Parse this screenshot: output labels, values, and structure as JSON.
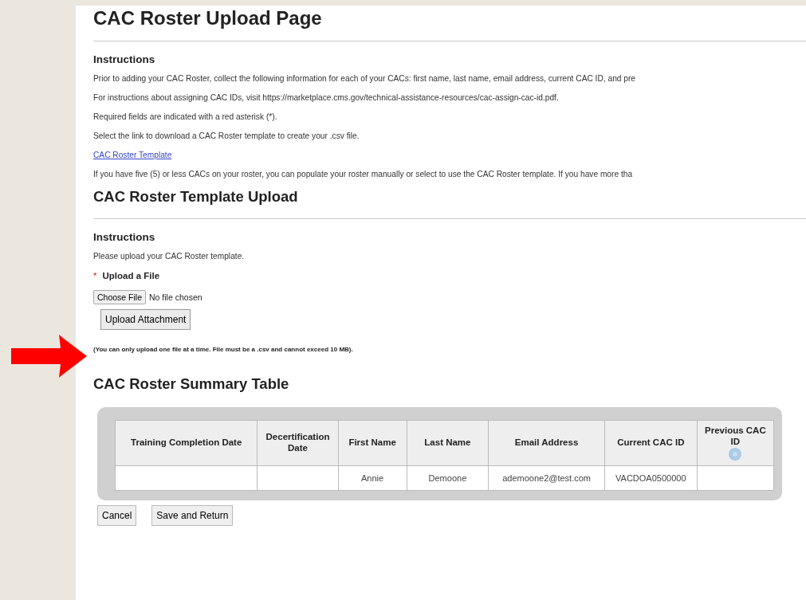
{
  "title": "CAC Roster Upload Page",
  "instructions": {
    "heading": "Instructions",
    "lines": [
      "Prior to adding your CAC Roster, collect the following information for each of your CACs: first name, last name, email address, current CAC ID, and pre",
      "For instructions about assigning CAC IDs, visit https://marketplace.cms.gov/technical-assistance-resources/cac-assign-cac-id.pdf.",
      "Required fields are indicated with a red asterisk (*).",
      "Select the link to download a CAC Roster template to create your .csv file."
    ],
    "link": "CAC Roster Template",
    "note": "If you have five (5) or less CACs on your roster, you can populate your roster manually or select to use the CAC Roster template. If you have more tha"
  },
  "upload": {
    "title": "CAC Roster Template Upload",
    "heading": "Instructions",
    "text": "Please upload your CAC Roster template.",
    "required_mark": "*",
    "field_label": "Upload a File",
    "choose_button": "Choose File",
    "file_status": "No file chosen",
    "upload_button": "Upload Attachment",
    "hint": "(You can only upload one file at a time. File must be a .csv and cannot exceed 10 MB)."
  },
  "summary": {
    "title": "CAC Roster Summary Table",
    "columns": [
      "Training Completion Date",
      "Decertification Date",
      "First Name",
      "Last Name",
      "Email Address",
      "Current CAC ID",
      "Previous CAC ID"
    ],
    "rows": [
      [
        "",
        "",
        "Annie",
        "Demoone",
        "ademoone2@test.com",
        "VACDOA0500000",
        ""
      ]
    ]
  },
  "buttons": [
    "Cancel",
    "Save and Return"
  ]
}
